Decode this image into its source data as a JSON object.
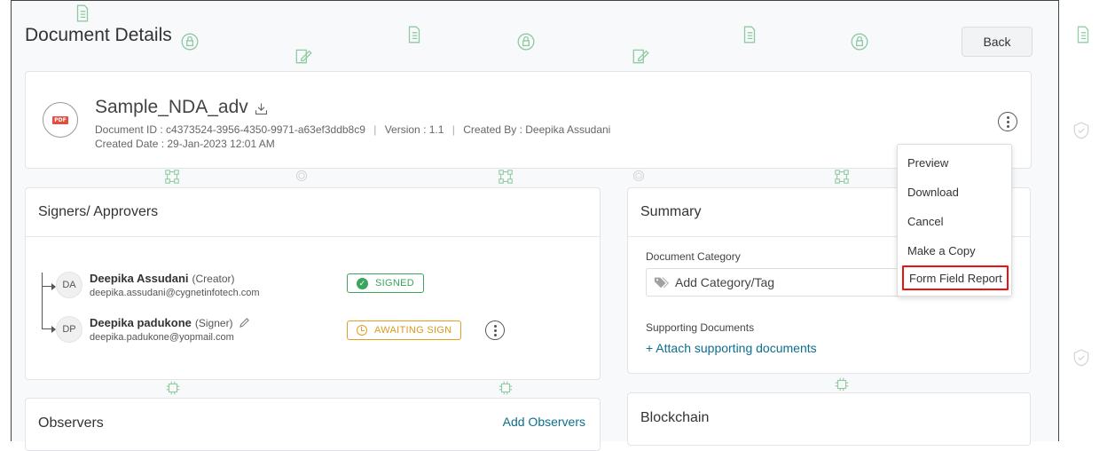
{
  "page": {
    "title": "Document Details",
    "back_label": "Back"
  },
  "document": {
    "name": "Sample_NDA_adv",
    "file_badge": "PDF",
    "document_id": "Document ID : c4373524-3956-4350-9971-a63ef3ddb8c9",
    "version": "Version : 1.1",
    "created_by": "Created By : Deepika Assudani",
    "created_date": "Created Date : 29-Jan-2023 12:01 AM",
    "separator": "|"
  },
  "menu": {
    "items": [
      {
        "label": "Preview"
      },
      {
        "label": "Download"
      },
      {
        "label": "Cancel"
      },
      {
        "label": "Make a Copy"
      },
      {
        "label": "Form Field Report"
      }
    ],
    "highlight_color": "#ee1111"
  },
  "signers": {
    "title": "Signers/ Approvers",
    "list": [
      {
        "initials": "DA",
        "name": "Deepika Assudani",
        "role": "(Creator)",
        "email": "deepika.assudani@cygnetinfotech.com",
        "status": "SIGNED",
        "status_color": "#3aa55c"
      },
      {
        "initials": "DP",
        "name": "Deepika padukone",
        "role": "(Signer)",
        "email": "deepika.padukone@yopmail.com",
        "status": "AWAITING SIGN",
        "status_color": "#e0a020"
      }
    ]
  },
  "summary": {
    "title": "Summary",
    "category_label": "Document Category",
    "category_placeholder": "Add Category/Tag",
    "supporting_label": "Supporting Documents",
    "attach_link": "+ Attach supporting documents"
  },
  "observers": {
    "title": "Observers",
    "add_label": "Add Observers"
  },
  "blockchain": {
    "title": "Blockchain"
  },
  "colors": {
    "link": "#0d6e8e",
    "watermark": "#3aa55c"
  }
}
